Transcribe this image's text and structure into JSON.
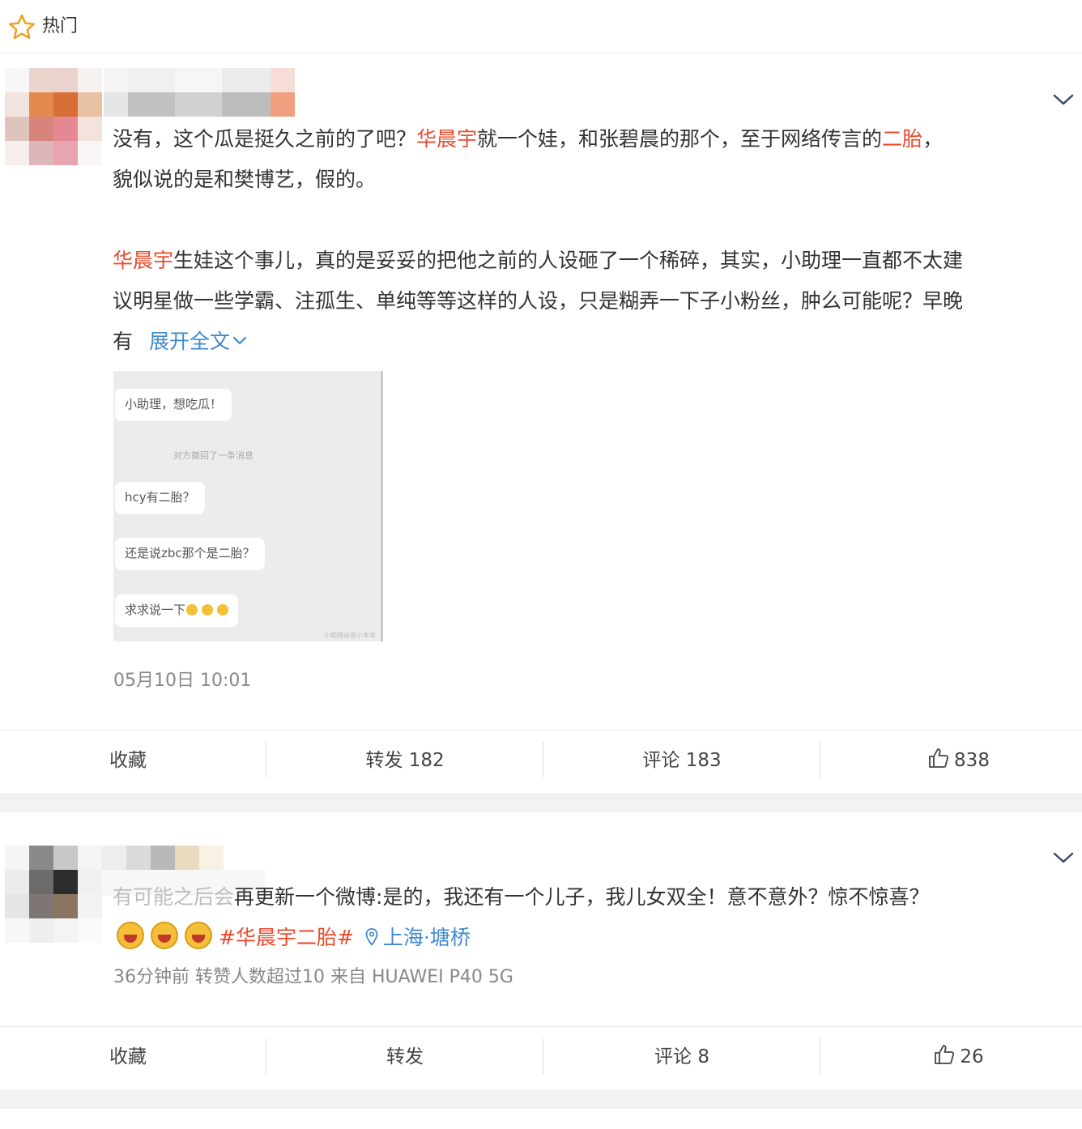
{
  "header": {
    "title": "热门"
  },
  "posts": [
    {
      "body": {
        "p1_line1_a": "没有，这个瓜是挺久之前的了吧？",
        "p1_line1_b": "华晨宇",
        "p1_line1_c": "就一个娃，和张碧晨的那个，至于网络传言的",
        "p1_line1_d": "二胎",
        "p1_line1_e": "，",
        "p1_line2": "貌似说的是和樊博艺，假的。",
        "p2_line1_a": "华晨宇",
        "p2_line1_b": "生娃这个事儿，真的是妥妥的把他之前的人设砸了一个稀碎，其实，小助理一直都不太建",
        "p2_line2": "议明星做一些学霸、注孤生、单纯等等这样的人设，只是糊弄一下子小粉丝，肿么可能呢？早晚",
        "p2_line3": "有",
        "expand": "展开全文"
      },
      "screenshot": {
        "bubble1": "小助理，想吃瓜！",
        "system": "对方撤回了一条消息",
        "bubble2": "hcy有二胎？",
        "bubble3": "还是说zbc那个是二胎？",
        "bubble4": "求求说一下",
        "watermark": "小助理说说小本本"
      },
      "meta": "05月10日 10:01",
      "actions": {
        "favorite": "收藏",
        "repost": "转发 182",
        "comment": "评论 183",
        "like": "838"
      }
    },
    {
      "body": {
        "line1_a": "有可能之后会",
        "line1_b": "再更新一个微博:是的，我还有一个儿子，我儿女双全！意不意外？惊不惊喜？",
        "hashtag": "#华晨宇二胎#",
        "location": "上海·塘桥"
      },
      "meta": "36分钟前  转赞人数超过10   来自 HUAWEI P40 5G",
      "actions": {
        "favorite": "收藏",
        "repost": "转发",
        "comment": "评论 8",
        "like": "26"
      }
    }
  ],
  "colors": {
    "accent_red": "#eb4b2c",
    "link_blue": "#3f8ad0",
    "star_orange": "#f0a021"
  },
  "icons": [
    "star-icon",
    "chevron-down-icon",
    "thumbs-up-icon",
    "location-pin-icon",
    "laughing-emoji-icon"
  ]
}
